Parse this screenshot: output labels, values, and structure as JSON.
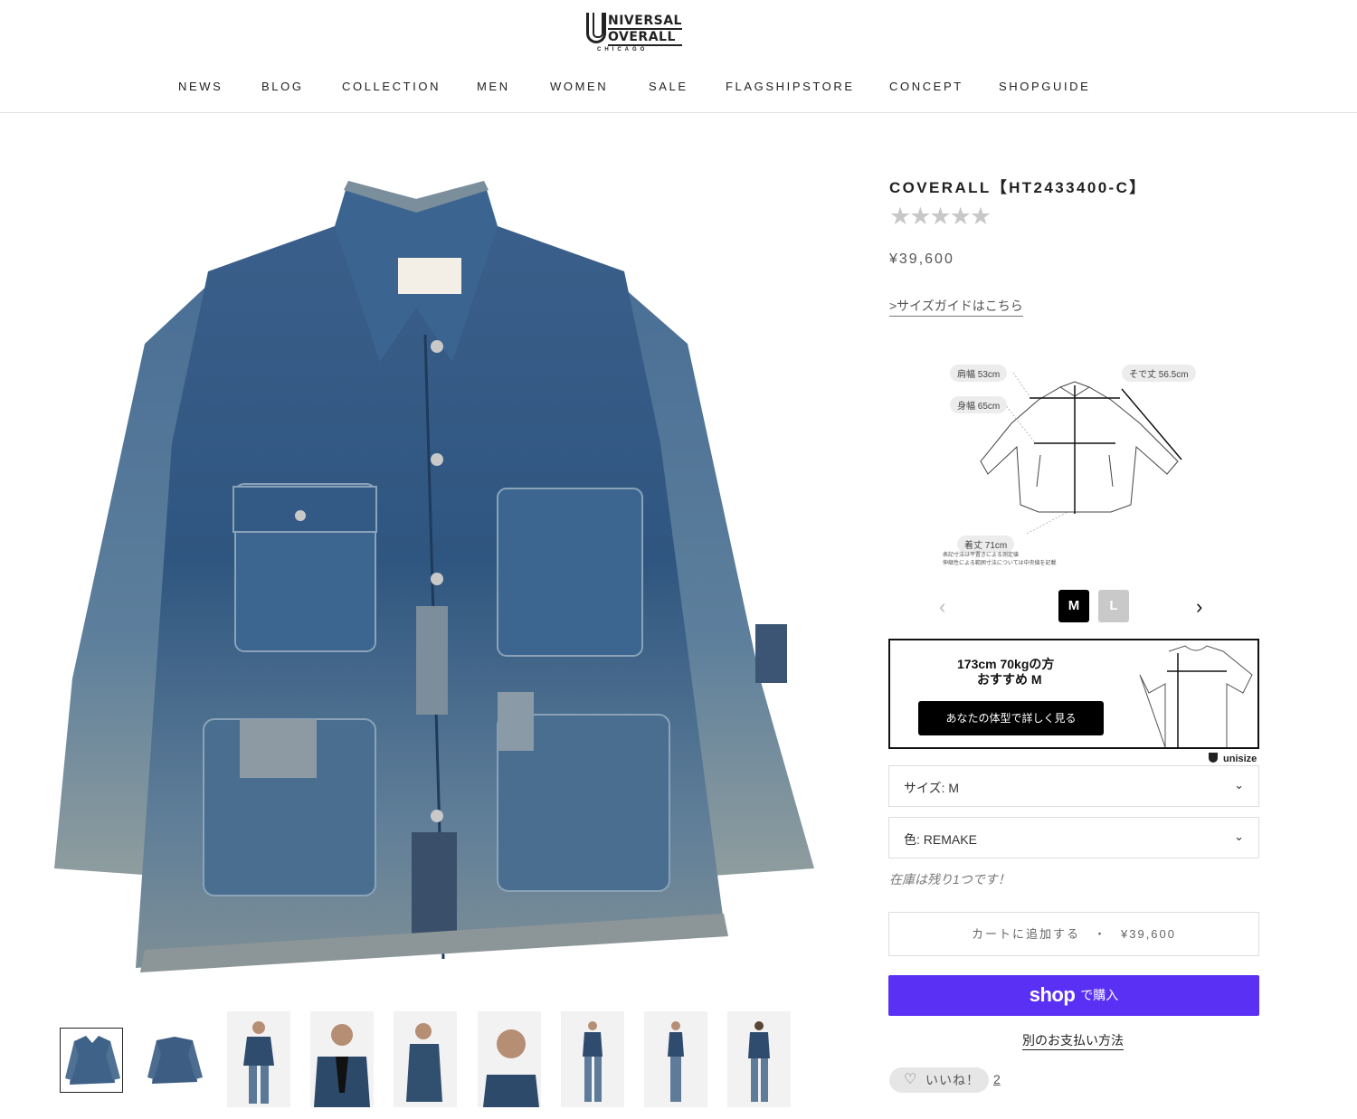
{
  "brand": {
    "logo_line1": "NIVERSAL",
    "logo_line2": "OVERALL",
    "logo_city": "CHICAGO"
  },
  "nav": {
    "items": [
      "NEWS",
      "BLOG",
      "COLLECTION",
      "MEN",
      "WOMEN",
      "SALE",
      "FLAGSHIPSTORE",
      "CONCEPT",
      "SHOPGUIDE"
    ]
  },
  "product": {
    "title": "COVERALL【HT2433400-C】",
    "rating_stars": "★★★★★",
    "rating_value": 0,
    "price": "¥39,600",
    "size_guide_link": ">サイズガイドはこちら"
  },
  "size_diagram": {
    "shoulder": "肩幅 53cm",
    "chest": "身幅 65cm",
    "sleeve": "そで丈 56.5cm",
    "length": "着丈 71cm",
    "note_line1": "表記寸法は平置きによる測定値",
    "note_line2": "伸縮性による範囲寸法については中央値を記載"
  },
  "size_tabs": {
    "prev": "‹",
    "next": "›",
    "sizes": [
      "M",
      "L"
    ],
    "selected": "M"
  },
  "unisize": {
    "recommend_line1": "173cm 70kgの方",
    "recommend_line2": "おすすめ M",
    "button": "あなたの体型で詳しく見る",
    "brand": "unisize"
  },
  "options": {
    "size_label": "サイズ: M",
    "color_label": "色: REMAKE",
    "arrow": "⌄"
  },
  "stock_notice": "在庫は残り1つです！",
  "cart": {
    "label": "カートに追加する　・　¥39,600"
  },
  "shop_pay": {
    "brand": "shop",
    "label": "で購入"
  },
  "alt_payment": "別のお支払い方法",
  "like": {
    "icon": "heart-icon",
    "label": "いいね！",
    "count": "2"
  },
  "thumbnails": [
    "front",
    "back",
    "model-front",
    "model-close",
    "model-side",
    "model-face",
    "model-full",
    "model-side-full",
    "model-back-full"
  ],
  "colors": {
    "shop_pay": "#5a31f4",
    "denim_dark": "#2d4d74",
    "denim_mid": "#486f96",
    "denim_light": "#8ba4ba"
  }
}
